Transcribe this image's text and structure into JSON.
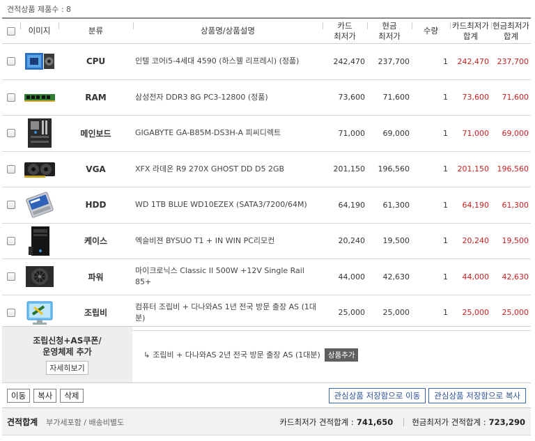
{
  "header": {
    "count_label": "견적상품 제품수 : 8"
  },
  "columns": {
    "image": "이미지",
    "category": "분류",
    "name": "상품명/상품설명",
    "card_line1": "카드",
    "card_line2": "최저가",
    "cash_line1": "현금",
    "cash_line2": "최저가",
    "qty": "수량",
    "card_total_line1": "카드최저가",
    "card_total_line2": "합계",
    "cash_total_line1": "현금최저가",
    "cash_total_line2": "합계"
  },
  "items": [
    {
      "icon": "cpu-image",
      "category": "CPU",
      "name": "인텔 코어i5-4세대 4590 (하스웰 리프레시) (정품)",
      "card": "242,470",
      "cash": "237,700",
      "qty": "1",
      "card_total": "242,470",
      "cash_total": "237,700"
    },
    {
      "icon": "ram-image",
      "category": "RAM",
      "name": "삼성전자 DDR3 8G PC3-12800 (정품)",
      "card": "73,600",
      "cash": "71,600",
      "qty": "1",
      "card_total": "73,600",
      "cash_total": "71,600"
    },
    {
      "icon": "mainboard-image",
      "category": "메인보드",
      "name": "GIGABYTE GA-B85M-DS3H-A 피씨디렉트",
      "card": "71,000",
      "cash": "69,000",
      "qty": "1",
      "card_total": "71,000",
      "cash_total": "69,000"
    },
    {
      "icon": "vga-image",
      "category": "VGA",
      "name": "XFX 라데온 R9 270X GHOST DD D5 2GB",
      "card": "201,150",
      "cash": "196,560",
      "qty": "1",
      "card_total": "201,150",
      "cash_total": "196,560"
    },
    {
      "icon": "hdd-image",
      "category": "HDD",
      "name": "WD 1TB BLUE WD10EZEX (SATA3/7200/64M)",
      "card": "64,190",
      "cash": "61,300",
      "qty": "1",
      "card_total": "64,190",
      "cash_total": "61,300"
    },
    {
      "icon": "case-image",
      "category": "케이스",
      "name": "엑슬비젼 BYSUO T1 + IN WIN PC리모컨",
      "card": "20,240",
      "cash": "19,500",
      "qty": "1",
      "card_total": "20,240",
      "cash_total": "19,500"
    },
    {
      "icon": "psu-image",
      "category": "파워",
      "name": "마이크로닉스 Classic II 500W +12V Single Rail 85+",
      "card": "44,000",
      "cash": "42,630",
      "qty": "1",
      "card_total": "44,000",
      "cash_total": "42,630"
    },
    {
      "icon": "assembly-image",
      "category": "조립비",
      "name": "컴퓨터 조립비 + 다나와AS 1년 전국 방문 출장 AS (1대분)",
      "card": "25,000",
      "cash": "25,000",
      "qty": "1",
      "card_total": "25,000",
      "cash_total": "25,000"
    }
  ],
  "assembly_option": {
    "title_line1": "조립신청+AS쿠폰/",
    "title_line2": "운영체제 추가",
    "detail_button": "자세히보기",
    "arrow": "↳",
    "description": "조립비 + 다나와AS 2년 전국 방문 출장 AS (1대분)",
    "add_button": "상품추가"
  },
  "actions": {
    "move": "이동",
    "copy": "복사",
    "delete": "삭제",
    "move_to_wishlist": "관심상품 저장함으로 이동",
    "copy_to_wishlist": "관심상품 저장함으로 복사"
  },
  "totals": {
    "label": "견적합계",
    "note": "부가세포함 / 배송비별도",
    "card_label": "카드최저가 견적합계 :",
    "card_value": "741,650",
    "cash_label": "현금최저가 견적합계 :",
    "cash_value": "723,290"
  },
  "colors": {
    "price_red": "#c81e1e",
    "button_blue": "#3a64b4",
    "add_button_bg": "#5f5f5f"
  }
}
